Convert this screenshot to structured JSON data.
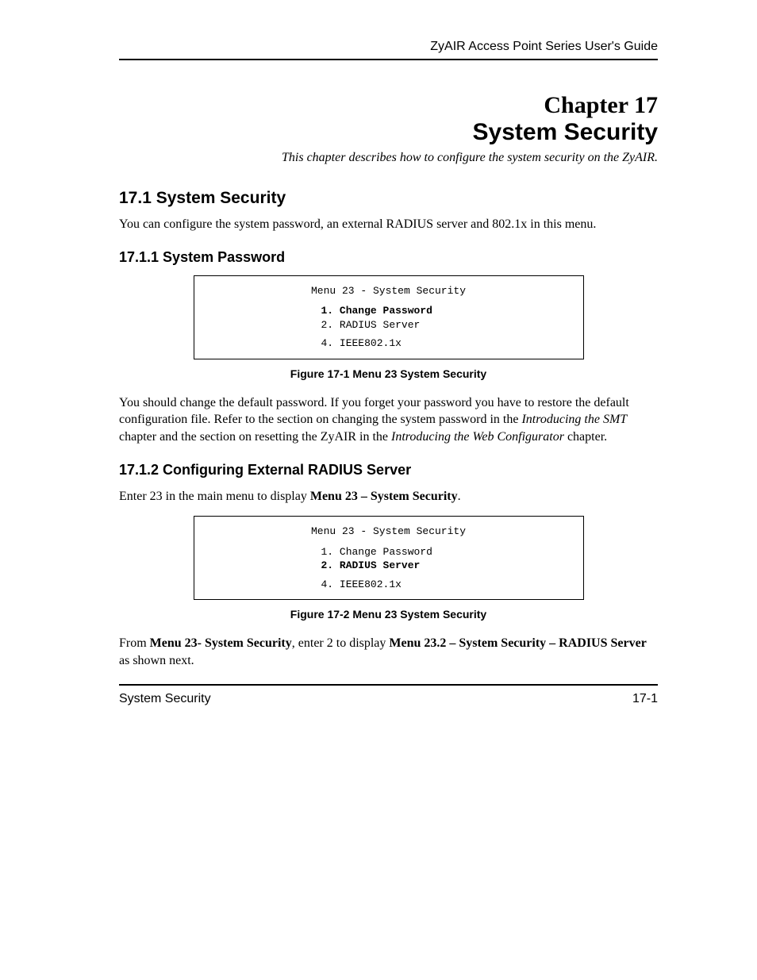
{
  "header": {
    "guide": "ZyAIR Access Point Series User's Guide"
  },
  "chapter": {
    "num": "Chapter 17",
    "title": "System Security",
    "subtitle": "This chapter describes how to configure the system security on the ZyAIR."
  },
  "s1": {
    "heading": "17.1  System Security",
    "body": "You can configure the system password, an external RADIUS server and 802.1x in this menu."
  },
  "s11": {
    "heading": "17.1.1 System Password",
    "menu": {
      "title": "Menu 23 - System Security",
      "item1": "1. Change Password",
      "item2": "2. RADIUS Server",
      "item4": "4. IEEE802.1x"
    },
    "caption": "Figure 17-1 Menu 23 System Security",
    "p1a": "You should change the default password. If you forget your password you have to restore the default configuration file. Refer to the section on changing the system password in the ",
    "p1_em1": "Introducing the SMT",
    "p1b": " chapter and the section on resetting the ZyAIR in the ",
    "p1_em2": "Introducing the Web Configurator",
    "p1c": " chapter."
  },
  "s12": {
    "heading": "17.1.2 Configuring External RADIUS Server",
    "intro_a": "Enter 23 in the main menu to display ",
    "intro_b": "Menu 23 – System Security",
    "intro_c": ".",
    "menu": {
      "title": "Menu 23 - System Security",
      "item1": "1. Change Password",
      "item2": "2. RADIUS Server",
      "item4": "4. IEEE802.1x"
    },
    "caption": "Figure 17-2 Menu 23 System Security",
    "p_a": "From ",
    "p_b": "Menu 23- System Security",
    "p_c": ", enter 2 to display ",
    "p_d": "Menu 23.2 – System Security – RADIUS Server",
    "p_e": " as shown next."
  },
  "footer": {
    "left": "System Security",
    "right": "17-1"
  }
}
